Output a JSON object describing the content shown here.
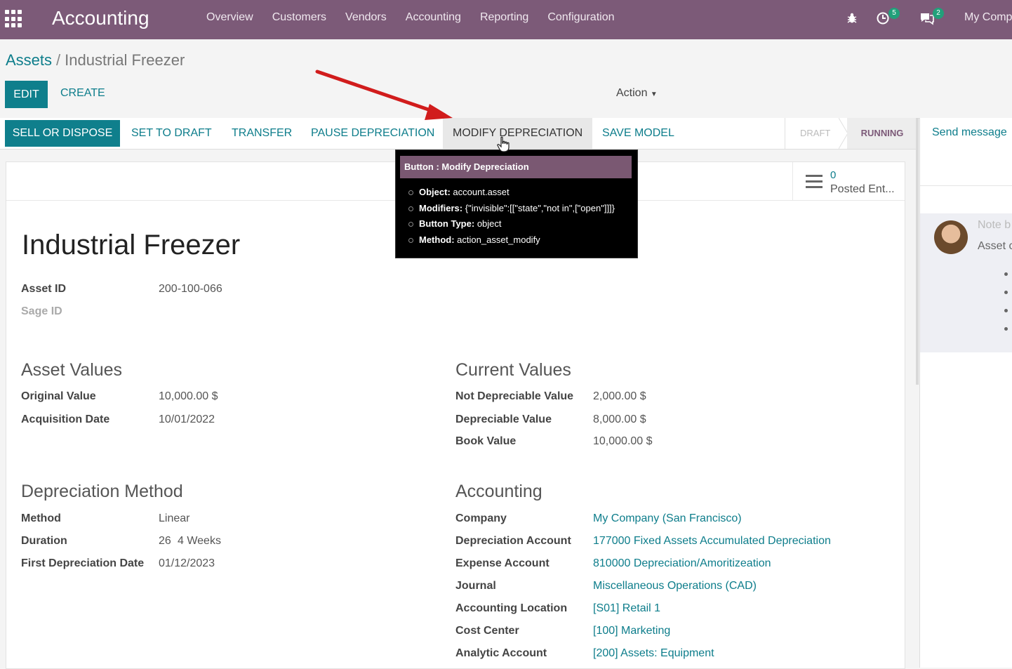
{
  "navbar": {
    "brand": "Accounting",
    "menu": [
      "Overview",
      "Customers",
      "Vendors",
      "Accounting",
      "Reporting",
      "Configuration"
    ],
    "activity_count": "5",
    "message_count": "2",
    "company": "My Comp"
  },
  "breadcrumb": {
    "parent": "Assets",
    "separator": "/",
    "current": "Industrial Freezer"
  },
  "controls": {
    "edit": "EDIT",
    "create": "CREATE",
    "action": "Action"
  },
  "statusbar": {
    "buttons": [
      "SELL OR DISPOSE",
      "SET TO DRAFT",
      "TRANSFER",
      "PAUSE DEPRECIATION",
      "MODIFY DEPRECIATION",
      "SAVE MODEL"
    ],
    "stages": [
      "DRAFT",
      "RUNNING"
    ],
    "active_stage": "RUNNING"
  },
  "tooltip": {
    "title": "Button : Modify Depreciation",
    "rows": [
      {
        "key": "Object:",
        "value": "account.asset"
      },
      {
        "key": "Modifiers:",
        "value": "{\"invisible\":[[\"state\",\"not in\",[\"open\"]]]}"
      },
      {
        "key": "Button Type:",
        "value": "object"
      },
      {
        "key": "Method:",
        "value": "action_asset_modify"
      }
    ]
  },
  "smart_button": {
    "count": "0",
    "label": "Posted Ent..."
  },
  "record": {
    "title": "Industrial Freezer",
    "asset_id_label": "Asset ID",
    "asset_id": "200-100-066",
    "sage_id_label": "Sage ID"
  },
  "asset_values": {
    "heading": "Asset Values",
    "original_value_label": "Original Value",
    "original_value": "10,000.00 $",
    "acquisition_date_label": "Acquisition Date",
    "acquisition_date": "10/01/2022"
  },
  "current_values": {
    "heading": "Current Values",
    "not_depreciable_label": "Not Depreciable Value",
    "not_depreciable": "2,000.00 $",
    "depreciable_label": "Depreciable Value",
    "depreciable": "8,000.00 $",
    "book_value_label": "Book Value",
    "book_value": "10,000.00 $"
  },
  "depreciation_method": {
    "heading": "Depreciation Method",
    "method_label": "Method",
    "method": "Linear",
    "duration_label": "Duration",
    "duration_num": "26",
    "duration_unit": "4 Weeks",
    "first_date_label": "First Depreciation Date",
    "first_date": "01/12/2023"
  },
  "accounting": {
    "heading": "Accounting",
    "rows": [
      {
        "label": "Company",
        "value": "My Company (San Francisco)"
      },
      {
        "label": "Depreciation Account",
        "value": "177000 Fixed Assets Accumulated Depreciation"
      },
      {
        "label": "Expense Account",
        "value": "810000 Depreciation/Amoritizeation"
      },
      {
        "label": "Journal",
        "value": "Miscellaneous Operations (CAD)"
      },
      {
        "label": "Accounting Location",
        "value": "[S01] Retail 1"
      },
      {
        "label": "Cost Center",
        "value": "[100] Marketing"
      },
      {
        "label": "Analytic Account",
        "value": "[200] Assets: Equipment"
      }
    ]
  },
  "chatter": {
    "send_message": "Send message",
    "note_line": "Note b",
    "note_text": "Asset c"
  },
  "colors": {
    "navbar": "#7c5a78",
    "primary": "#0f7f8c",
    "link": "#0d7d8b",
    "arrow": "#d11c1c"
  }
}
